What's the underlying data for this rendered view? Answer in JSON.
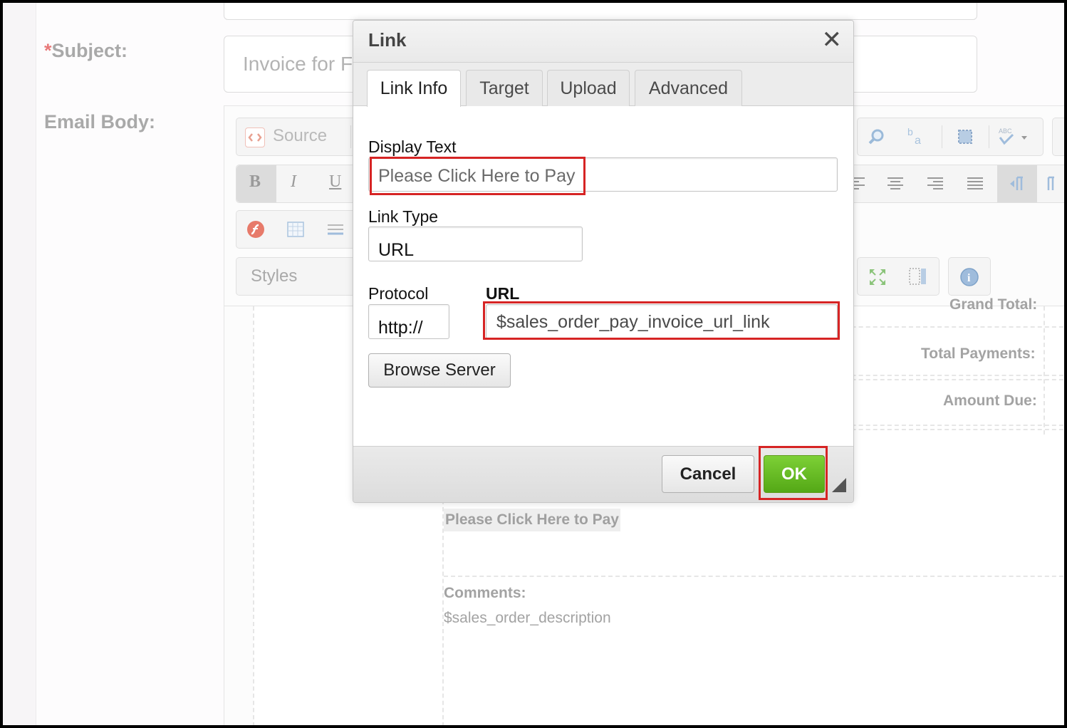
{
  "form": {
    "subject_label": "Subject:",
    "subject_required_mark": "*",
    "subject_value": "Invoice for F",
    "email_body_label": "Email Body:"
  },
  "editor": {
    "source_label": "Source",
    "bold": "B",
    "italic": "I",
    "underline": "U",
    "styles_label": "Styles",
    "content": {
      "grand_total": "Grand Total:",
      "total_payments": "Total Payments:",
      "amount_due": "Amount Due:",
      "pay_link_text": "Please Click Here to Pay",
      "comments_label": "Comments:",
      "comments_value": "$sales_order_description"
    }
  },
  "dialog": {
    "title": "Link",
    "close_glyph": "✕",
    "tabs": [
      {
        "label": "Link Info",
        "active": true
      },
      {
        "label": "Target",
        "active": false
      },
      {
        "label": "Upload",
        "active": false
      },
      {
        "label": "Advanced",
        "active": false
      }
    ],
    "display_text_label": "Display Text",
    "display_text_value": "Please Click Here to Pay",
    "link_type_label": "Link Type",
    "link_type_value": "URL",
    "protocol_label": "Protocol",
    "protocol_value": "http://",
    "url_label": "URL",
    "url_value": "$sales_order_pay_invoice_url_link",
    "browse_server_label": "Browse Server",
    "cancel_label": "Cancel",
    "ok_label": "OK"
  },
  "colors": {
    "highlight_border": "#d62424",
    "ok_button": "#5fb41c",
    "required_mark": "#e87979"
  }
}
